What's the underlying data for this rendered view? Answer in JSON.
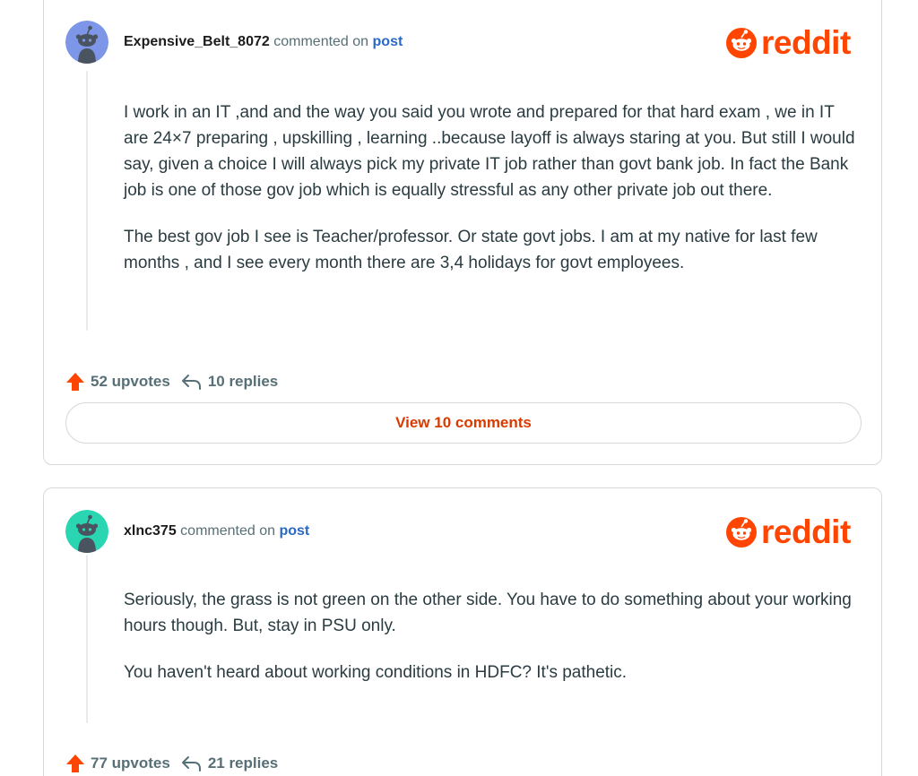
{
  "comments": [
    {
      "username": "Expensive_Belt_8072",
      "action_text": "commented on",
      "post_link": "post",
      "brand": "reddit",
      "avatar_color": "#7e96e8",
      "paragraphs": [
        "I work in an IT ,and and the way you said you wrote and prepared for that hard exam , we in IT are 24×7 preparing , upskilling , learning ..because layoff is always staring at you. But still I would say, given a choice I will always pick my private IT job rather than govt bank job. In fact the Bank job is one of those gov job which is equally stressful as any other private job out there.",
        "The best gov job I see is Teacher/professor. Or state govt jobs. I am at my native for last few months , and I see every month there are 3,4 holidays for govt employees."
      ],
      "upvotes": "52 upvotes",
      "replies": "10 replies",
      "view_comments": "View 10 comments"
    },
    {
      "username": "xlnc375",
      "action_text": "commented on",
      "post_link": "post",
      "brand": "reddit",
      "avatar_color": "#2ad6b2",
      "paragraphs": [
        "Seriously, the grass is not green on the other side. You have to do something about your working hours though. But, stay in PSU only.",
        "You haven't heard about working conditions in HDFC? It's pathetic."
      ],
      "upvotes": "77 upvotes",
      "replies": "21 replies"
    }
  ],
  "colors": {
    "brand_orange": "#ff4500",
    "link_blue": "#2b67c3",
    "view_comments_text": "#d93a00"
  },
  "icons": [
    "snoo-avatar-icon",
    "reddit-snoo-logo-icon",
    "upvote-arrow-icon",
    "reply-arrow-icon"
  ]
}
